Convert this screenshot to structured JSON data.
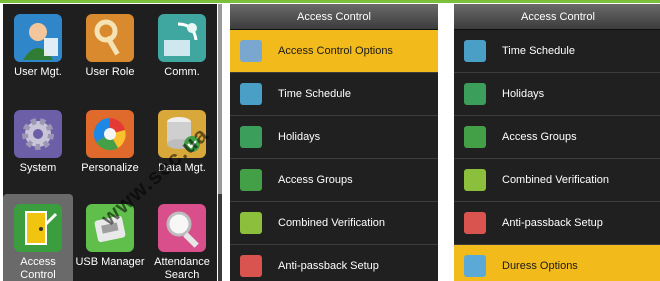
{
  "apps": [
    {
      "label": "User Mgt.",
      "icon": "user-icon"
    },
    {
      "label": "User Role",
      "icon": "key-icon"
    },
    {
      "label": "Comm.",
      "icon": "satellite-icon"
    },
    {
      "label": "System",
      "icon": "gear-icon"
    },
    {
      "label": "Personalize",
      "icon": "palette-icon"
    },
    {
      "label": "Data Mgt.",
      "icon": "database-icon"
    },
    {
      "label": "Access Control",
      "icon": "door-icon"
    },
    {
      "label": "USB Manager",
      "icon": "usb-icon"
    },
    {
      "label": "Attendance Search",
      "icon": "magnifier-icon"
    }
  ],
  "panel1": {
    "title": "Access Control",
    "items": [
      "Access Control Options",
      "Time Schedule",
      "Holidays",
      "Access Groups",
      "Combined Verification",
      "Anti-passback Setup"
    ],
    "selected": "Access Control Options"
  },
  "panel2": {
    "title": "Access Control",
    "items": [
      "Time Schedule",
      "Holidays",
      "Access Groups",
      "Combined Verification",
      "Anti-passback Setup",
      "Duress Options"
    ],
    "selected": "Duress Options"
  },
  "watermark": "www.sec.ua",
  "colors": {
    "highlight": "#f2ba1b",
    "panel": "#202020",
    "accent_line": "#7bbf3a"
  }
}
